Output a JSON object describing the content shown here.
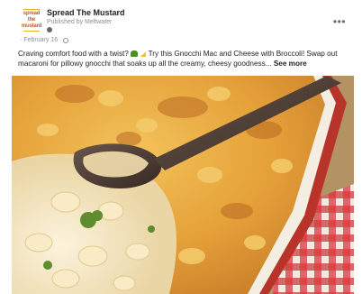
{
  "post": {
    "page_name": "Spread The Mustard",
    "published_by": "Published by Meltwater",
    "date": "February 16",
    "avatar_text": "spread the mustard",
    "more_label": "•••",
    "caption_start": "Craving comfort food with a twist?",
    "caption_mid": "Try this Gnocchi Mac and Cheese with Broccoli! Swap out macaroni for pillowy gnocchi that soaks up all the creamy, cheesy goodness...",
    "see_more": "See more"
  },
  "image": {
    "subject": "gnocchi-mac-and-cheese-with-broccoli",
    "colors": {
      "cheese": "#e9a93a",
      "cream": "#f3e6c3",
      "spoon": "#4a3a33",
      "dish_rim": "#f4efe6",
      "dish_red": "#c0362c",
      "towel_red": "#c8232c",
      "background": "#b89a6a"
    }
  }
}
